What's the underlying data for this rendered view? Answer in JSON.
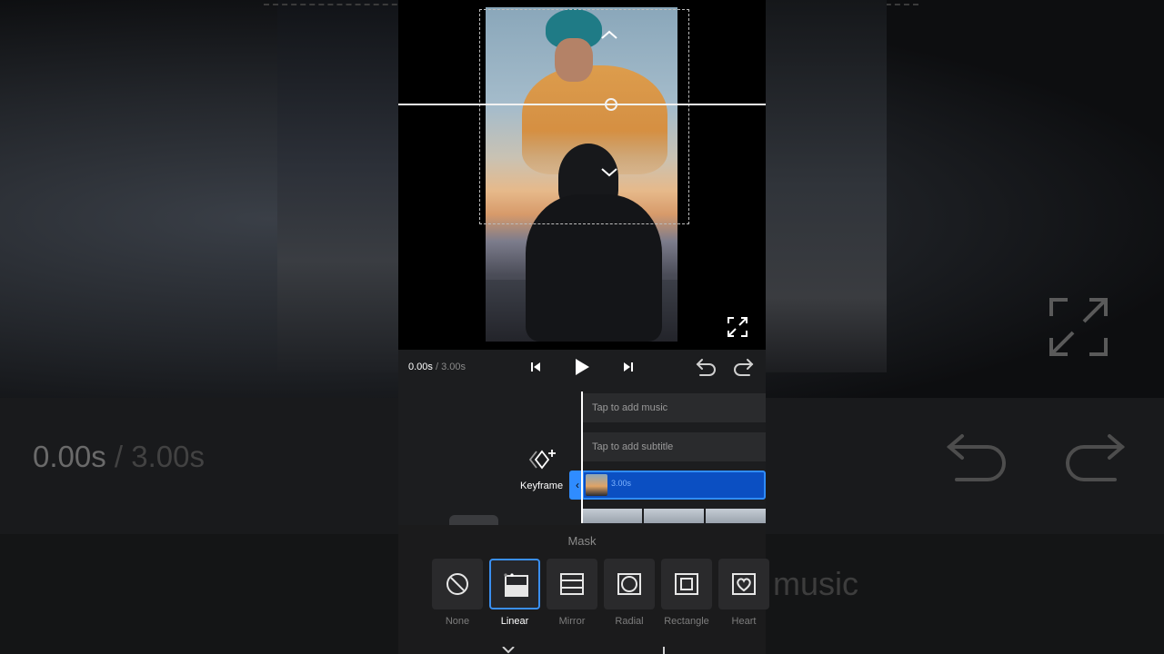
{
  "background": {
    "time_current": "0.00s",
    "time_total": "/ 3.00s",
    "music_hint": "music"
  },
  "controls": {
    "time_current": "0.00s",
    "time_total": " / 3.00s"
  },
  "timeline": {
    "music_track": "Tap to add music",
    "subtitle_track": "Tap to add subtitle",
    "clip_duration": "3.00s",
    "keyframe_label": "Keyframe"
  },
  "mask_panel": {
    "title": "Mask",
    "selected": "Linear",
    "options": [
      {
        "label": "None",
        "icon": "none-icon"
      },
      {
        "label": "Linear",
        "icon": "linear-mask-icon"
      },
      {
        "label": "Mirror",
        "icon": "mirror-mask-icon"
      },
      {
        "label": "Radial",
        "icon": "radial-mask-icon"
      },
      {
        "label": "Rectangle",
        "icon": "rectangle-mask-icon"
      },
      {
        "label": "Heart",
        "icon": "heart-mask-icon"
      }
    ]
  },
  "colors": {
    "accent": "#2f8cff",
    "clip_fill": "#0b4fc2",
    "panel_bg": "#1b1b1c"
  }
}
